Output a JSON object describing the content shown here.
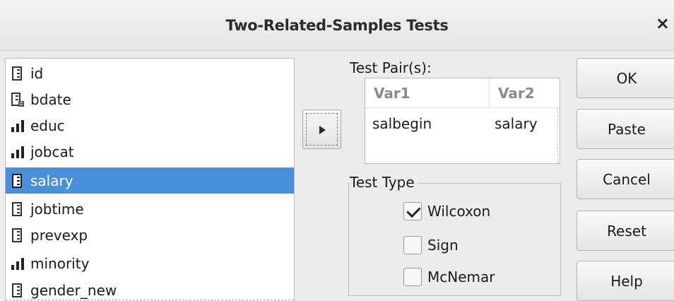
{
  "window": {
    "title": "Two-Related-Samples Tests",
    "close_label": "×"
  },
  "variables": [
    {
      "label": "id",
      "icon": "scale-ruler-icon",
      "selected": false
    },
    {
      "label": "bdate",
      "icon": "date-scale-icon",
      "selected": false
    },
    {
      "label": "educ",
      "icon": "ordinal-bars-icon",
      "selected": false
    },
    {
      "label": "jobcat",
      "icon": "ordinal-bars-icon",
      "selected": false
    },
    {
      "label": "salary",
      "icon": "scale-ruler-icon",
      "selected": true
    },
    {
      "label": "jobtime",
      "icon": "scale-ruler-icon",
      "selected": false
    },
    {
      "label": "prevexp",
      "icon": "scale-ruler-icon",
      "selected": false
    },
    {
      "label": "minority",
      "icon": "ordinal-bars-icon",
      "selected": false
    },
    {
      "label": "gender_new",
      "icon": "scale-ruler-icon",
      "selected": false
    }
  ],
  "test_pairs": {
    "label": "Test Pair(s):",
    "columns": [
      "Var1",
      "Var2"
    ],
    "rows": [
      {
        "var1": "salbegin",
        "var2": "salary"
      }
    ]
  },
  "test_type": {
    "legend": "Test Type",
    "options": [
      {
        "label": "Wilcoxon",
        "checked": true
      },
      {
        "label": "Sign",
        "checked": false
      },
      {
        "label": "McNemar",
        "checked": false
      }
    ]
  },
  "buttons": {
    "ok": "OK",
    "paste": "Paste",
    "cancel": "Cancel",
    "reset": "Reset",
    "help": "Help"
  },
  "colors": {
    "selection": "#4a8fd9",
    "background": "#ececec"
  }
}
